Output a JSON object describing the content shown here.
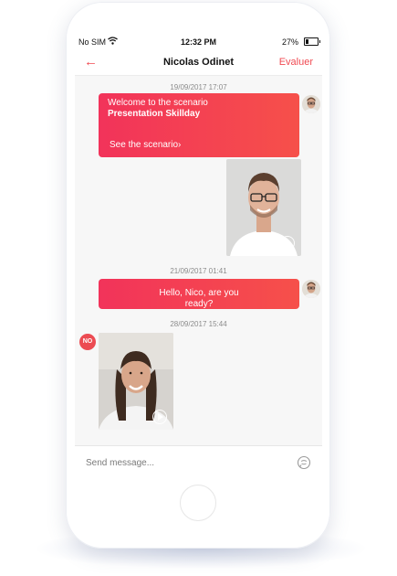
{
  "status_bar": {
    "carrier": "No SIM",
    "time": "12:32 PM",
    "battery": "27%",
    "battery_level": 0.27,
    "wifi_icon": "wifi-icon",
    "battery_icon": "battery-icon"
  },
  "header": {
    "back_icon": "arrow-left-icon",
    "back_glyph": "←",
    "title": "Nicolas Odinet",
    "action_label": "Evaluer"
  },
  "messages": [
    {
      "timestamp": "19/09/2017 17:07",
      "line1": "Welcome to the scenario",
      "line2": "Presentation Skillday",
      "link": "See the scenario›"
    },
    {
      "timestamp": "21/09/2017 01:41",
      "line1": "Hello, Nico, are you",
      "line2": "ready?"
    },
    {
      "timestamp": "28/09/2017 15:44",
      "sender_badge": "NO"
    }
  ],
  "composer": {
    "placeholder": "Send message...",
    "send_icon": "chat-bubble-icon"
  },
  "colors": {
    "accent": "#f04a52",
    "bubble_gradient_start": "#f2335a",
    "bubble_gradient_end": "#f6504a",
    "badge": "#ec4b52"
  }
}
